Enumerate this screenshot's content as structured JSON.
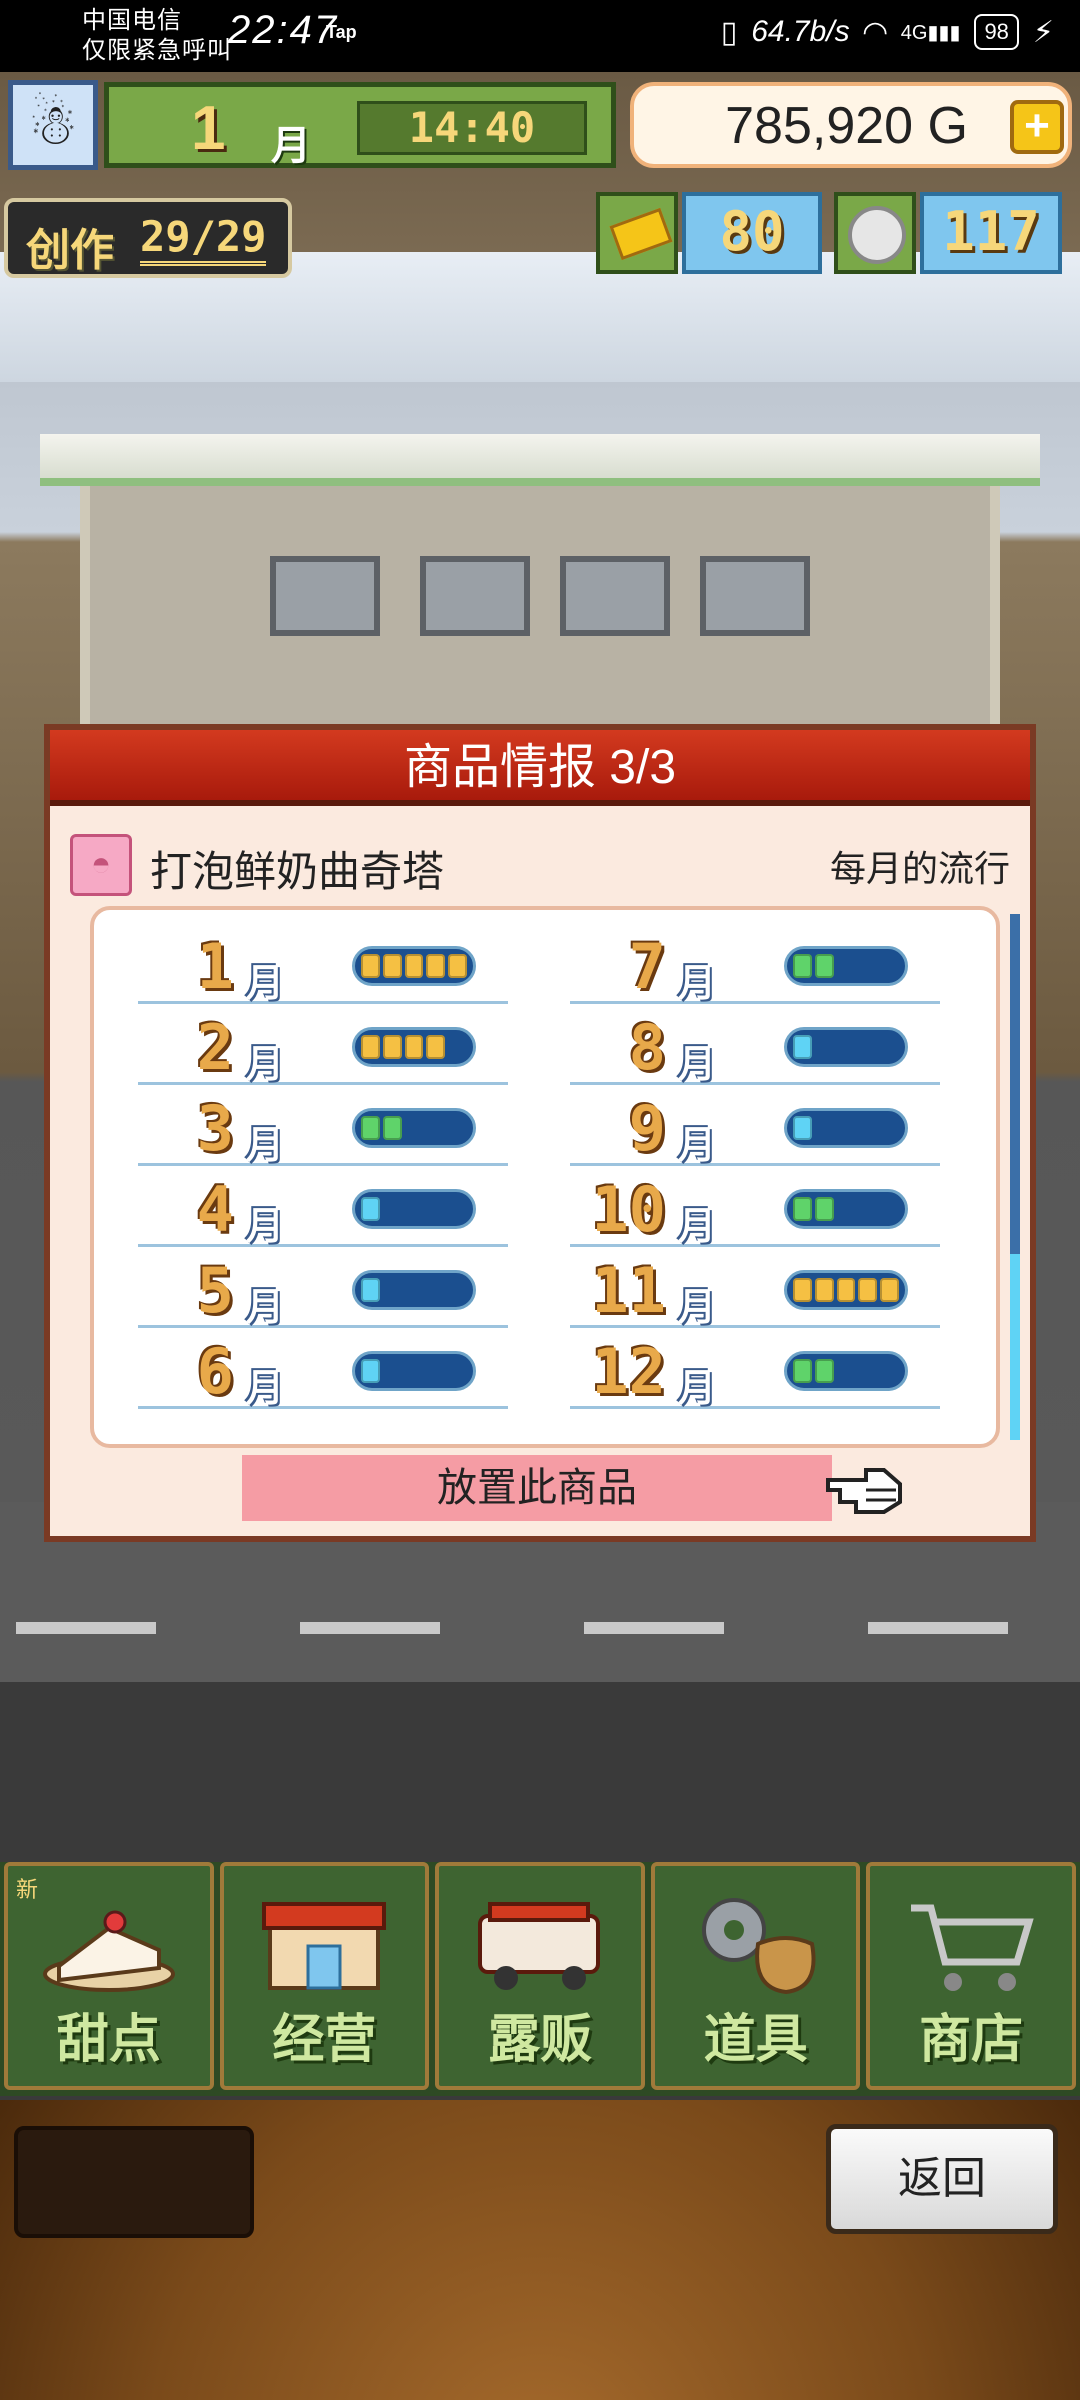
{
  "status_bar": {
    "carrier_line1": "中国电信",
    "carrier_line2": "仅限紧急呼叫",
    "time": "22:47",
    "tap_label": "Tap",
    "net_speed": "64.7b/s",
    "signal": "4G",
    "battery": "98"
  },
  "hud": {
    "month": "1",
    "month_unit": "月",
    "clock": "14:40",
    "money": "785,920 G",
    "money_add": "+",
    "create_label": "创作",
    "create_count": "29/29",
    "ticket_count": "80",
    "coin_count": "117"
  },
  "dialog": {
    "title": "商品情报 3/3",
    "item_name": "打泡鲜奶曲奇塔",
    "trend_title": "每月的流行",
    "month_unit": "月",
    "months": [
      {
        "m": "1",
        "level": 5,
        "color": "#f5c043"
      },
      {
        "m": "2",
        "level": 4,
        "color": "#f5c043"
      },
      {
        "m": "3",
        "level": 2,
        "color": "#5fd36a"
      },
      {
        "m": "4",
        "level": 1,
        "color": "#5fd3f5"
      },
      {
        "m": "5",
        "level": 1,
        "color": "#5fd3f5"
      },
      {
        "m": "6",
        "level": 1,
        "color": "#5fd3f5"
      },
      {
        "m": "7",
        "level": 2,
        "color": "#5fd36a"
      },
      {
        "m": "8",
        "level": 1,
        "color": "#5fd3f5"
      },
      {
        "m": "9",
        "level": 1,
        "color": "#5fd3f5"
      },
      {
        "m": "10",
        "level": 2,
        "color": "#5fd36a"
      },
      {
        "m": "11",
        "level": 5,
        "color": "#f5c043"
      },
      {
        "m": "12",
        "level": 2,
        "color": "#5fd36a"
      }
    ],
    "max_level": 5,
    "place_button": "放置此商品"
  },
  "menu": {
    "new_badge": "新",
    "items": [
      {
        "label": "甜点",
        "icon": "cake-icon"
      },
      {
        "label": "经营",
        "icon": "shop-icon"
      },
      {
        "label": "露贩",
        "icon": "food-truck-icon"
      },
      {
        "label": "道具",
        "icon": "gear-bag-icon"
      },
      {
        "label": "商店",
        "icon": "cart-icon"
      }
    ]
  },
  "back_button": "返回"
}
